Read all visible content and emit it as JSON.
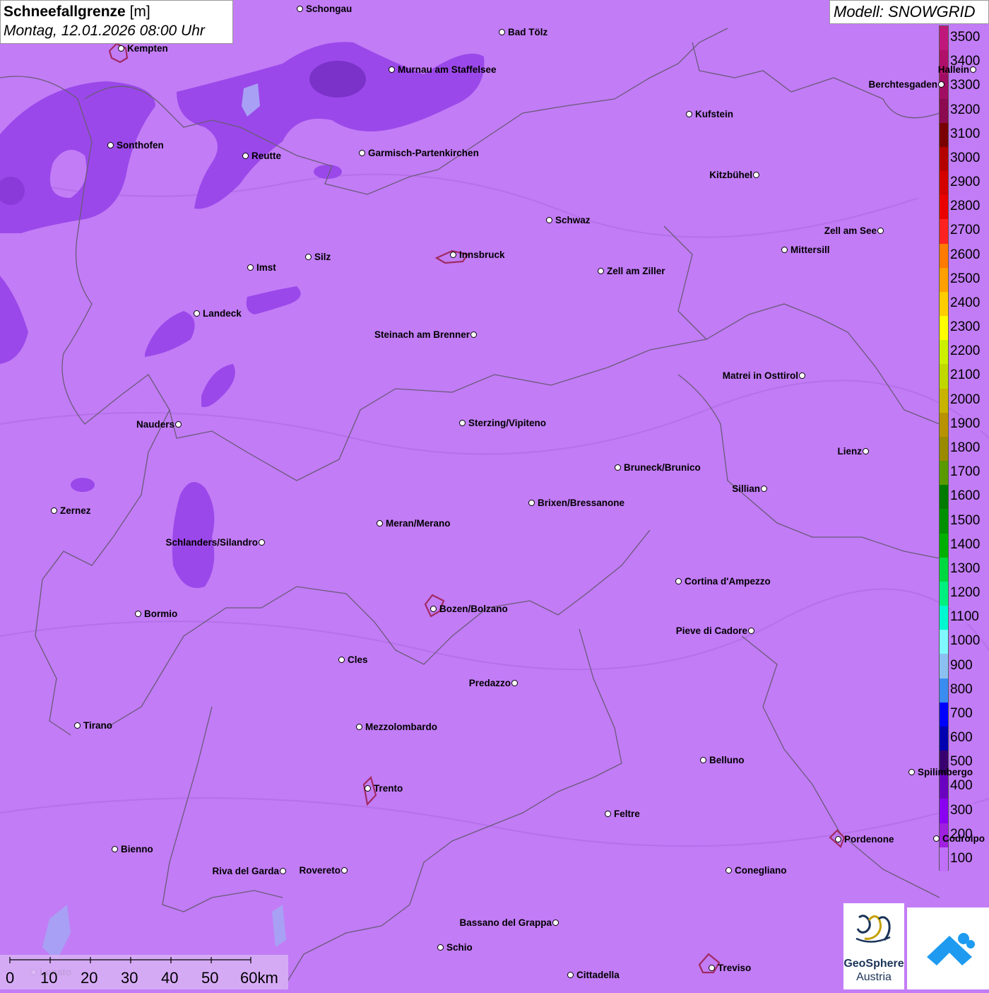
{
  "title": {
    "parameter": "Schneefallgrenze",
    "unit": "[m]",
    "datetime": "Montag, 12.01.2026 08:00 Uhr"
  },
  "model": "Modell: SNOWGRID",
  "legend": [
    {
      "value": "3500",
      "color": "#c0187a"
    },
    {
      "value": "3400",
      "color": "#b0106a"
    },
    {
      "value": "3300",
      "color": "#a00d62"
    },
    {
      "value": "3200",
      "color": "#8c0a50"
    },
    {
      "value": "3100",
      "color": "#7a0000"
    },
    {
      "value": "3000",
      "color": "#b50000"
    },
    {
      "value": "2900",
      "color": "#d40000"
    },
    {
      "value": "2800",
      "color": "#ea0000"
    },
    {
      "value": "2700",
      "color": "#ff2222"
    },
    {
      "value": "2600",
      "color": "#ff7a00"
    },
    {
      "value": "2500",
      "color": "#ffa000"
    },
    {
      "value": "2400",
      "color": "#ffcc00"
    },
    {
      "value": "2300",
      "color": "#ffff00"
    },
    {
      "value": "2200",
      "color": "#ccf000"
    },
    {
      "value": "2100",
      "color": "#c0d800"
    },
    {
      "value": "2000",
      "color": "#c8b400"
    },
    {
      "value": "1900",
      "color": "#b89200"
    },
    {
      "value": "1800",
      "color": "#9a8a00"
    },
    {
      "value": "1700",
      "color": "#5a9a00"
    },
    {
      "value": "1600",
      "color": "#007a00"
    },
    {
      "value": "1500",
      "color": "#009000"
    },
    {
      "value": "1400",
      "color": "#00b000"
    },
    {
      "value": "1300",
      "color": "#00d840"
    },
    {
      "value": "1200",
      "color": "#00f080"
    },
    {
      "value": "1100",
      "color": "#00f8d0"
    },
    {
      "value": "1000",
      "color": "#80f8ff"
    },
    {
      "value": "900",
      "color": "#8cc0f0"
    },
    {
      "value": "800",
      "color": "#3a8cf0"
    },
    {
      "value": "700",
      "color": "#0000ff"
    },
    {
      "value": "600",
      "color": "#0000b0"
    },
    {
      "value": "500",
      "color": "#3a0070"
    },
    {
      "value": "400",
      "color": "#6a00c0"
    },
    {
      "value": "300",
      "color": "#8a00f0"
    },
    {
      "value": "200",
      "color": "#a020e0"
    },
    {
      "value": "100",
      "color": "#c070f8"
    }
  ],
  "cities": [
    {
      "name": "Schongau",
      "side": "r"
    },
    {
      "name": "Bad Tölz",
      "side": "r"
    },
    {
      "name": "Kempten",
      "side": "r"
    },
    {
      "name": "Murnau am Staffelsee",
      "side": "r"
    },
    {
      "name": "Berchtesgaden",
      "side": "l"
    },
    {
      "name": "Hallein",
      "side": "l"
    },
    {
      "name": "Kufstein",
      "side": "r"
    },
    {
      "name": "Sonthofen",
      "side": "r"
    },
    {
      "name": "Reutte",
      "side": "r"
    },
    {
      "name": "Garmisch-Partenkirchen",
      "side": "r"
    },
    {
      "name": "Kitzbühel",
      "side": "l"
    },
    {
      "name": "Schwaz",
      "side": "r"
    },
    {
      "name": "Zell am See",
      "side": "l"
    },
    {
      "name": "Mittersill",
      "side": "r"
    },
    {
      "name": "Innsbruck",
      "side": "r"
    },
    {
      "name": "Silz",
      "side": "r"
    },
    {
      "name": "Imst",
      "side": "r"
    },
    {
      "name": "Zell am Ziller",
      "side": "r"
    },
    {
      "name": "Landeck",
      "side": "r"
    },
    {
      "name": "Steinach am Brenner",
      "side": "l"
    },
    {
      "name": "Matrei in Osttirol",
      "side": "l"
    },
    {
      "name": "Nauders",
      "side": "l"
    },
    {
      "name": "Sterzing/Vipiteno",
      "side": "r"
    },
    {
      "name": "Lienz",
      "side": "l"
    },
    {
      "name": "Bruneck/Brunico",
      "side": "r"
    },
    {
      "name": "Sillian",
      "side": "l"
    },
    {
      "name": "Brixen/Bressanone",
      "side": "r"
    },
    {
      "name": "Zernez",
      "side": "r"
    },
    {
      "name": "Meran/Merano",
      "side": "r"
    },
    {
      "name": "Schlanders/Silandro",
      "side": "l"
    },
    {
      "name": "Cortina d'Ampezzo",
      "side": "r"
    },
    {
      "name": "Bozen/Bolzano",
      "side": "r"
    },
    {
      "name": "Bormio",
      "side": "r"
    },
    {
      "name": "Pieve di Cadore",
      "side": "l"
    },
    {
      "name": "Cles",
      "side": "r"
    },
    {
      "name": "Predazzo",
      "side": "l"
    },
    {
      "name": "Tirano",
      "side": "r"
    },
    {
      "name": "Mezzolombardo",
      "side": "r"
    },
    {
      "name": "Belluno",
      "side": "r"
    },
    {
      "name": "Spilimbergo",
      "side": "r"
    },
    {
      "name": "Trento",
      "side": "r"
    },
    {
      "name": "Feltre",
      "side": "r"
    },
    {
      "name": "Pordenone",
      "side": "r"
    },
    {
      "name": "Codroipo",
      "side": "r"
    },
    {
      "name": "Bienno",
      "side": "r"
    },
    {
      "name": "Riva del Garda",
      "side": "l"
    },
    {
      "name": "Rovereto",
      "side": "l"
    },
    {
      "name": "Conegliano",
      "side": "r"
    },
    {
      "name": "Bassano del Grappa",
      "side": "l"
    },
    {
      "name": "Schio",
      "side": "r"
    },
    {
      "name": "Treviso",
      "side": "r"
    },
    {
      "name": "Cittadella",
      "side": "r"
    },
    {
      "name": "Lonato",
      "side": "r"
    }
  ],
  "scalebar": {
    "labels": [
      "0",
      "10",
      "20",
      "30",
      "40",
      "50",
      "60km"
    ]
  },
  "logos": {
    "geosphere_line1": "GeoSphere",
    "geosphere_line2": "Austria"
  }
}
